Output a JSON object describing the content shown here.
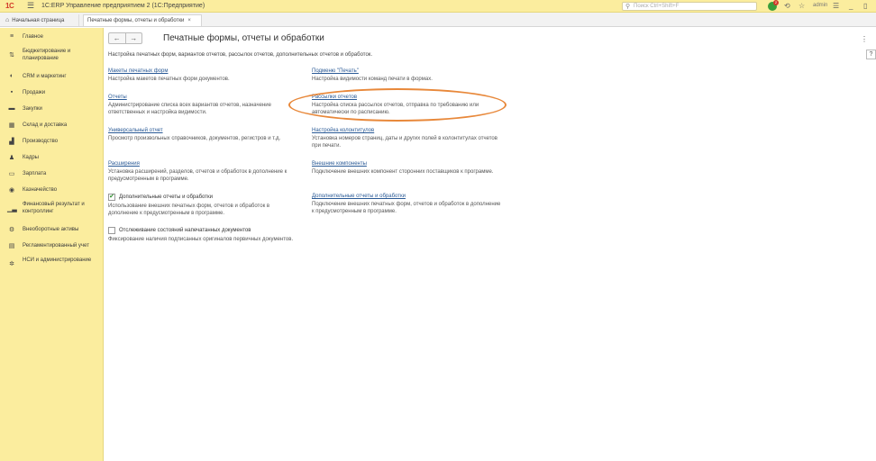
{
  "app": {
    "logo": "1C",
    "title": "1С:ERP Управление предприятием 2 (1С:Предприятие)",
    "search_placeholder": "Поиск Ctrl+Shift+F",
    "user": "admin",
    "notif_count": "2"
  },
  "tabs": [
    {
      "label": "Начальная страница"
    },
    {
      "label": "Печатные формы, отчеты и обработки"
    }
  ],
  "sidebar": {
    "items": [
      {
        "label": "Главное",
        "icon": "menu-icon"
      },
      {
        "label": "Бюджетирование и планирование",
        "icon": "budget-icon"
      },
      {
        "label": "CRM и маркетинг",
        "icon": "crm-icon"
      },
      {
        "label": "Продажи",
        "icon": "sales-icon"
      },
      {
        "label": "Закупки",
        "icon": "purchases-icon"
      },
      {
        "label": "Склад и доставка",
        "icon": "warehouse-icon"
      },
      {
        "label": "Производство",
        "icon": "production-icon"
      },
      {
        "label": "Кадры",
        "icon": "hr-icon"
      },
      {
        "label": "Зарплата",
        "icon": "salary-icon"
      },
      {
        "label": "Казначейство",
        "icon": "treasury-icon"
      },
      {
        "label": "Финансовый результат и контроллинг",
        "icon": "finance-icon"
      },
      {
        "label": "Внеоборотные активы",
        "icon": "assets-icon"
      },
      {
        "label": "Регламентированный учет",
        "icon": "accounting-icon"
      },
      {
        "label": "НСИ и администрирование",
        "icon": "settings-icon"
      }
    ]
  },
  "page": {
    "title": "Печатные формы, отчеты и обработки",
    "subtitle": "Настройка печатных форм, вариантов отчетов, рассылок отчетов, дополнительных отчетов и обработок.",
    "back": "←",
    "forward": "→",
    "more": "⋮",
    "help": "?"
  },
  "left_items": [
    {
      "link": "Макеты печатных форм",
      "desc": "Настройка макетов печатных форм документов."
    },
    {
      "link": "Отчеты",
      "desc": "Администрирование списка всех вариантов отчетов, назначение ответственных и настройка видимости."
    },
    {
      "link": "Универсальный отчет",
      "desc": "Просмотр произвольных справочников, документов, регистров и т.д."
    },
    {
      "link": "Расширения",
      "desc": "Установка расширений, разделов, отчетов и обработок в дополнение к предусмотренным в программе."
    },
    {
      "checkbox": true,
      "link": "Дополнительные отчеты и обработки",
      "desc": "Использование внешних печатных форм, отчетов и обработок в дополнение к предусмотренным в программе."
    },
    {
      "checkbox": false,
      "link": "Отслеживание состояний напечатанных документов",
      "desc": "Фиксирование наличия подписанных оригиналов первичных документов."
    }
  ],
  "right_items": [
    {
      "link": "Подменю \"Печать\"",
      "desc": "Настройка видимости команд печати в формах."
    },
    {
      "link": "Рассылки отчетов",
      "desc": "Настройка списка рассылок отчетов, отправка по требованию или автоматически по расписанию."
    },
    {
      "link": "Настройка колонтитулов",
      "desc": "Установка номеров страниц, даты и других полей в колонтитулах отчетов при печати."
    },
    {
      "link": "Внешние компоненты",
      "desc": "Подключение внешних компонент сторонних поставщиков к программе."
    },
    {
      "link": "Дополнительные отчеты и обработки",
      "desc": "Подключение внешних печатных форм, отчетов и обработок в дополнение к предусмотренным в программе."
    }
  ]
}
